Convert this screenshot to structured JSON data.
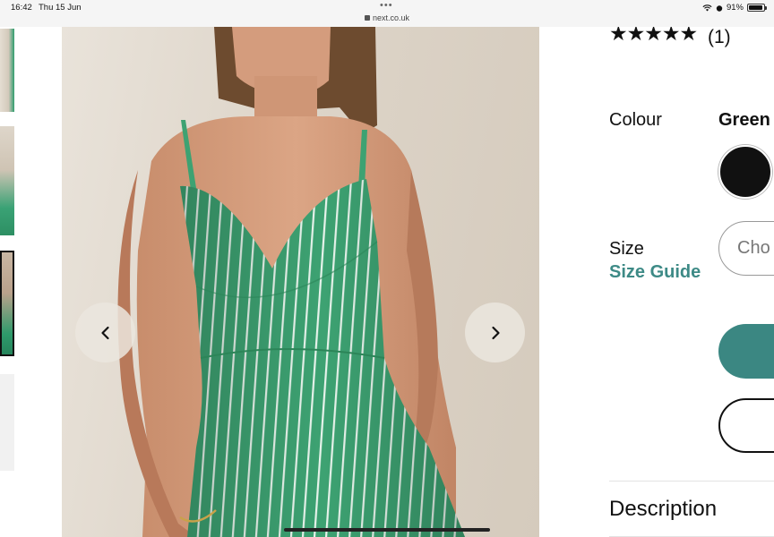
{
  "status_bar": {
    "time": "16:42",
    "date": "Thu 15 Jun",
    "url": "next.co.uk",
    "battery": "91%"
  },
  "product": {
    "rating_stars": "★★★★★",
    "review_count": "(1)",
    "colour_label": "Colour",
    "colour_value": "Green",
    "size_label": "Size",
    "size_guide_label": "Size Guide",
    "size_select_placeholder": "Cho",
    "description_label": "Description"
  },
  "colors": {
    "accent": "#3b8782",
    "link": "#3d8a86",
    "dress_green": "#3da272"
  },
  "icons": {
    "prev": "chevron-left-icon",
    "next": "chevron-right-icon"
  }
}
